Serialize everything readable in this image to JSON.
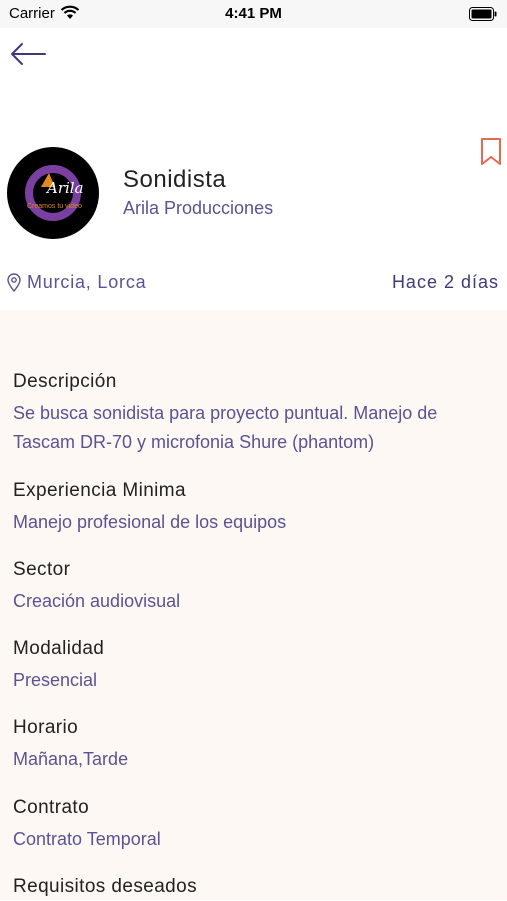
{
  "status_bar": {
    "carrier": "Carrier",
    "time": "4:41 PM"
  },
  "icons": {
    "back": "arrow-left-icon",
    "bookmark": "bookmark-icon",
    "location": "location-pin-icon",
    "wifi": "wifi-icon",
    "battery": "battery-icon"
  },
  "colors": {
    "accent": "#5b5391",
    "bookmark": "#e56a4f",
    "panel_background": "#fdf8f4"
  },
  "job": {
    "title": "Sonidista",
    "company": "Arila Producciones",
    "logo_text": "Arila",
    "logo_tagline": "Creamos tu video",
    "location": "Murcia, Lorca",
    "posted": "Hace 2 días"
  },
  "details": [
    {
      "label": "Descripción",
      "value": "Se busca sonidista para proyecto puntual. Manejo de Tascam DR-70 y microfonia Shure (phantom)"
    },
    {
      "label": "Experiencia Minima",
      "value": "Manejo profesional de los equipos"
    },
    {
      "label": "Sector",
      "value": "Creación audiovisual"
    },
    {
      "label": "Modalidad",
      "value": "Presencial"
    },
    {
      "label": "Horario",
      "value": "Mañana,Tarde"
    },
    {
      "label": "Contrato",
      "value": "Contrato Temporal"
    },
    {
      "label": "Requisitos deseados",
      "value": ""
    }
  ]
}
